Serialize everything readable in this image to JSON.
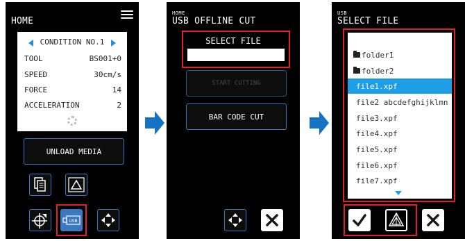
{
  "screen1": {
    "title": "HOME",
    "condition": {
      "header": "CONDITION NO.1",
      "rows": [
        {
          "label": "TOOL",
          "value": "BS001+0"
        },
        {
          "label": "SPEED",
          "value": "30cm/s"
        },
        {
          "label": "FORCE",
          "value": "14"
        },
        {
          "label": "ACCELERATION",
          "value": "2"
        }
      ]
    },
    "unload_label": "UNLOAD MEDIA",
    "usb_icon_label": "USB"
  },
  "screen2": {
    "breadcrumb": "HOME",
    "title": "USB OFFLINE CUT",
    "select_file_label": "SELECT FILE",
    "select_file_value": "",
    "start_cutting_label": "START CUTTING",
    "bar_code_label": "BAR CODE CUT"
  },
  "screen3": {
    "breadcrumb": "USB",
    "title": "SELECT FILE",
    "files": [
      {
        "name": "folder1",
        "type": "folder"
      },
      {
        "name": "folder2",
        "type": "folder"
      },
      {
        "name": "file1.xpf",
        "type": "file",
        "selected": true
      },
      {
        "name": "file2 abcdefghijklmn",
        "type": "file"
      },
      {
        "name": "file3.xpf",
        "type": "file"
      },
      {
        "name": "file4.xpf",
        "type": "file"
      },
      {
        "name": "file5.xpf",
        "type": "file"
      },
      {
        "name": "file6.xpf",
        "type": "file"
      },
      {
        "name": "file7.xpf",
        "type": "file"
      }
    ]
  },
  "colors": {
    "accent_blue": "#3a78c2",
    "highlight_red": "#e0232b",
    "selection_blue": "#1f9ee8",
    "flow_arrow": "#1673c4"
  },
  "icons": {
    "menu": "hamburger-icon",
    "prev": "triangle-left-icon",
    "next": "triangle-right-icon",
    "settings": "gear-icon",
    "copy": "copy-icon",
    "triangle": "triangle-icon",
    "origin": "origin-crosshair-icon",
    "usb": "usb-icon",
    "move": "move-arrows-icon",
    "close": "close-icon",
    "confirm": "check-icon",
    "shape": "shape-icon"
  }
}
